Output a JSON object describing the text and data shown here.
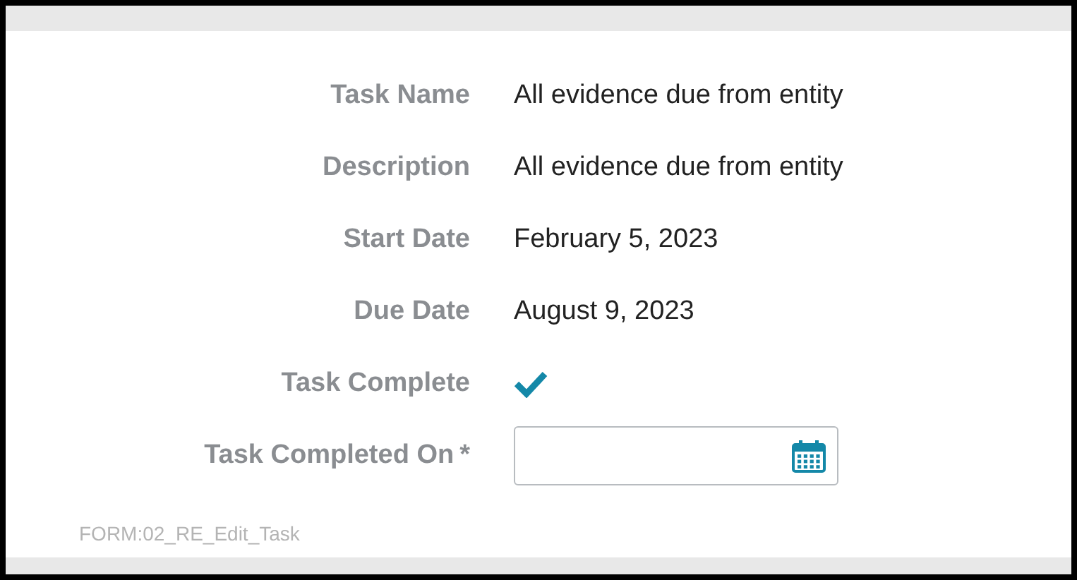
{
  "fields": [
    {
      "label": "Task Name",
      "kind": "text",
      "value": "All evidence due from entity"
    },
    {
      "label": "Description",
      "kind": "text",
      "value": "All evidence due from entity"
    },
    {
      "label": "Start Date",
      "kind": "text",
      "value": "February 5, 2023"
    },
    {
      "label": "Due Date",
      "kind": "text",
      "value": "August 9, 2023"
    },
    {
      "label": "Task Complete",
      "kind": "check",
      "checked": true
    },
    {
      "label": "Task Completed On",
      "kind": "date",
      "required_mark": "*"
    }
  ],
  "form_id": "FORM:02_RE_Edit_Task"
}
